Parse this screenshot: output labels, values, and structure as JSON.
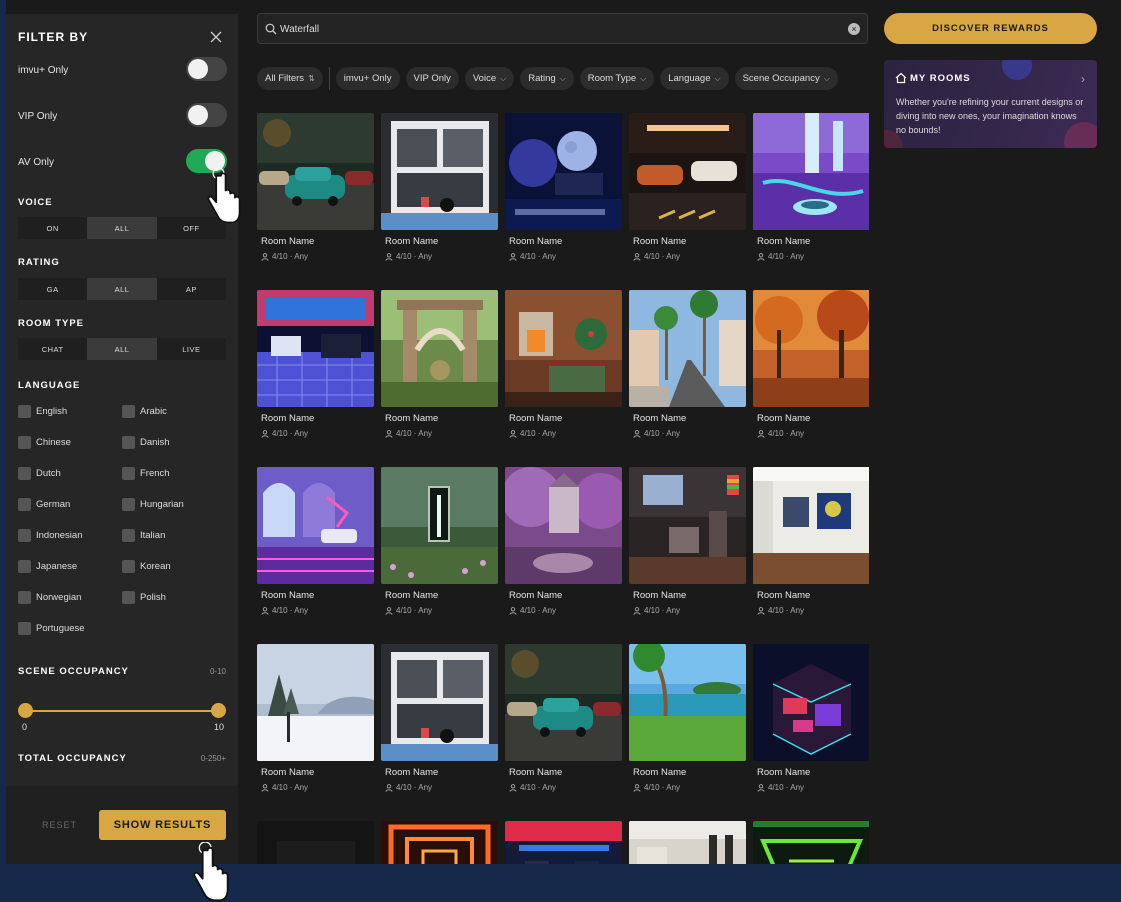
{
  "filter_panel": {
    "title": "FILTER BY",
    "toggles": [
      {
        "label": "imvu+ Only",
        "on": false
      },
      {
        "label": "VIP Only",
        "on": false
      },
      {
        "label": "AV Only",
        "on": true
      }
    ],
    "voice": {
      "title": "VOICE",
      "options": [
        "ON",
        "ALL",
        "OFF"
      ],
      "selected": "ALL"
    },
    "rating": {
      "title": "RATING",
      "options": [
        "GA",
        "ALL",
        "AP"
      ],
      "selected": "ALL"
    },
    "room_type": {
      "title": "ROOM TYPE",
      "options": [
        "CHAT",
        "ALL",
        "LIVE"
      ],
      "selected": "ALL"
    },
    "language": {
      "title": "LANGUAGE",
      "options": [
        "English",
        "Arabic",
        "Chinese",
        "Danish",
        "Dutch",
        "French",
        "German",
        "Hungarian",
        "Indonesian",
        "Italian",
        "Japanese",
        "Korean",
        "Norwegian",
        "Polish",
        "Portuguese"
      ]
    },
    "scene_occupancy": {
      "title": "SCENE OCCUPANCY",
      "range_label": "0-10",
      "min": "0",
      "max": "10"
    },
    "total_occupancy": {
      "title": "TOTAL OCCUPANCY",
      "range_label": "0-250+"
    },
    "reset_label": "RESET",
    "show_results_label": "SHOW RESULTS"
  },
  "search": {
    "value": "Waterfall"
  },
  "chips": [
    {
      "label": "All Filters",
      "icon": "sort-icon"
    },
    {
      "label": "imvu+ Only"
    },
    {
      "label": "VIP Only"
    },
    {
      "label": "Voice",
      "dropdown": true
    },
    {
      "label": "Rating",
      "dropdown": true
    },
    {
      "label": "Room Type",
      "dropdown": true
    },
    {
      "label": "Language",
      "dropdown": true
    },
    {
      "label": "Scene Occupancy",
      "dropdown": true
    }
  ],
  "rooms": [
    {
      "name": "Room Name",
      "meta": "4/10 · Any",
      "theme": "garage-car"
    },
    {
      "name": "Room Name",
      "meta": "4/10 · Any",
      "theme": "modern-house"
    },
    {
      "name": "Room Name",
      "meta": "4/10 · Any",
      "theme": "moon-night"
    },
    {
      "name": "Room Name",
      "meta": "4/10 · Any",
      "theme": "neon-garage"
    },
    {
      "name": "Room Name",
      "meta": "4/10 · Any",
      "theme": "purple-waterfall"
    },
    {
      "name": "Room Name",
      "meta": "4/10 · Any",
      "theme": "dance-floor"
    },
    {
      "name": "Room Name",
      "meta": "4/10 · Any",
      "theme": "garden-ruins"
    },
    {
      "name": "Room Name",
      "meta": "4/10 · Any",
      "theme": "cabin-fireplace"
    },
    {
      "name": "Room Name",
      "meta": "4/10 · Any",
      "theme": "palm-street"
    },
    {
      "name": "Room Name",
      "meta": "4/10 · Any",
      "theme": "autumn-forest"
    },
    {
      "name": "Room Name",
      "meta": "4/10 · Any",
      "theme": "purple-lounge"
    },
    {
      "name": "Room Name",
      "meta": "4/10 · Any",
      "theme": "portal-meadow"
    },
    {
      "name": "Room Name",
      "meta": "4/10 · Any",
      "theme": "lilac-garden"
    },
    {
      "name": "Room Name",
      "meta": "4/10 · Any",
      "theme": "loft-interior"
    },
    {
      "name": "Room Name",
      "meta": "4/10 · Any",
      "theme": "art-gallery"
    },
    {
      "name": "Room Name",
      "meta": "4/10 · Any",
      "theme": "snow-field"
    },
    {
      "name": "Room Name",
      "meta": "4/10 · Any",
      "theme": "modern-house"
    },
    {
      "name": "Room Name",
      "meta": "4/10 · Any",
      "theme": "garage-car"
    },
    {
      "name": "Room Name",
      "meta": "4/10 · Any",
      "theme": "tropical-island"
    },
    {
      "name": "Room Name",
      "meta": "4/10 · Any",
      "theme": "neon-bedroom"
    },
    {
      "name": "",
      "meta": "",
      "theme": "dark-room"
    },
    {
      "name": "",
      "meta": "",
      "theme": "orange-tunnel"
    },
    {
      "name": "",
      "meta": "",
      "theme": "neon-club"
    },
    {
      "name": "",
      "meta": "",
      "theme": "modern-hall"
    },
    {
      "name": "",
      "meta": "",
      "theme": "green-neon"
    }
  ],
  "sidebar_right": {
    "rewards_label": "DISCOVER REWARDS",
    "my_rooms_title": "MY ROOMS",
    "my_rooms_desc": "Whether you're refining your current designs or diving into new ones, your imagination knows no bounds!"
  },
  "colors": {
    "accent": "#d8a744",
    "toggle_on": "#1faa55",
    "bg": "#1a1a1a",
    "panel": "#262626",
    "band": "#15294a"
  }
}
